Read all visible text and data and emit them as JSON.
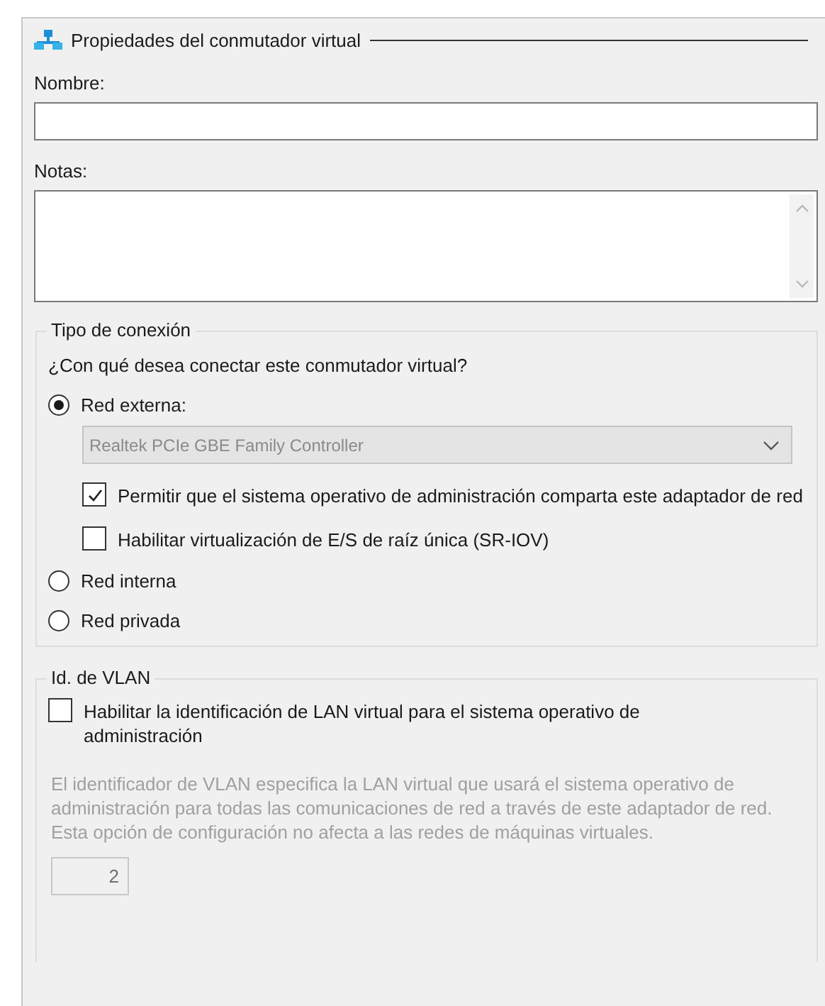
{
  "panel": {
    "title": "Propiedades del conmutador virtual"
  },
  "name_field": {
    "label": "Nombre:"
  },
  "notes_field": {
    "label": "Notas:"
  },
  "connection_group": {
    "title": "Tipo de conexión",
    "question": "¿Con qué desea conectar este conmutador virtual?",
    "options": [
      {
        "label": "Red externa:",
        "selected": true,
        "adapter": "Realtek PCIe GBE Family Controller",
        "checks": [
          {
            "label": "Permitir que el sistema operativo de administración comparta este adaptador de red",
            "checked": true
          },
          {
            "label": "Habilitar virtualización de E/S de raíz única (SR-IOV)",
            "checked": false
          }
        ]
      },
      {
        "label": "Red interna",
        "selected": false
      },
      {
        "label": "Red privada",
        "selected": false
      }
    ]
  },
  "vlan_group": {
    "title": "Id. de VLAN",
    "check": {
      "label": "Habilitar la identificación de LAN virtual para el sistema operativo de administración",
      "checked": false
    },
    "description": "El identificador de VLAN especifica la LAN virtual que usará el sistema operativo de administración para todas las comunicaciones de red a través de este adaptador de red. Esta opción de configuración no afecta a las redes de máquinas virtuales.",
    "vlan_id": "2",
    "disabled": true
  }
}
